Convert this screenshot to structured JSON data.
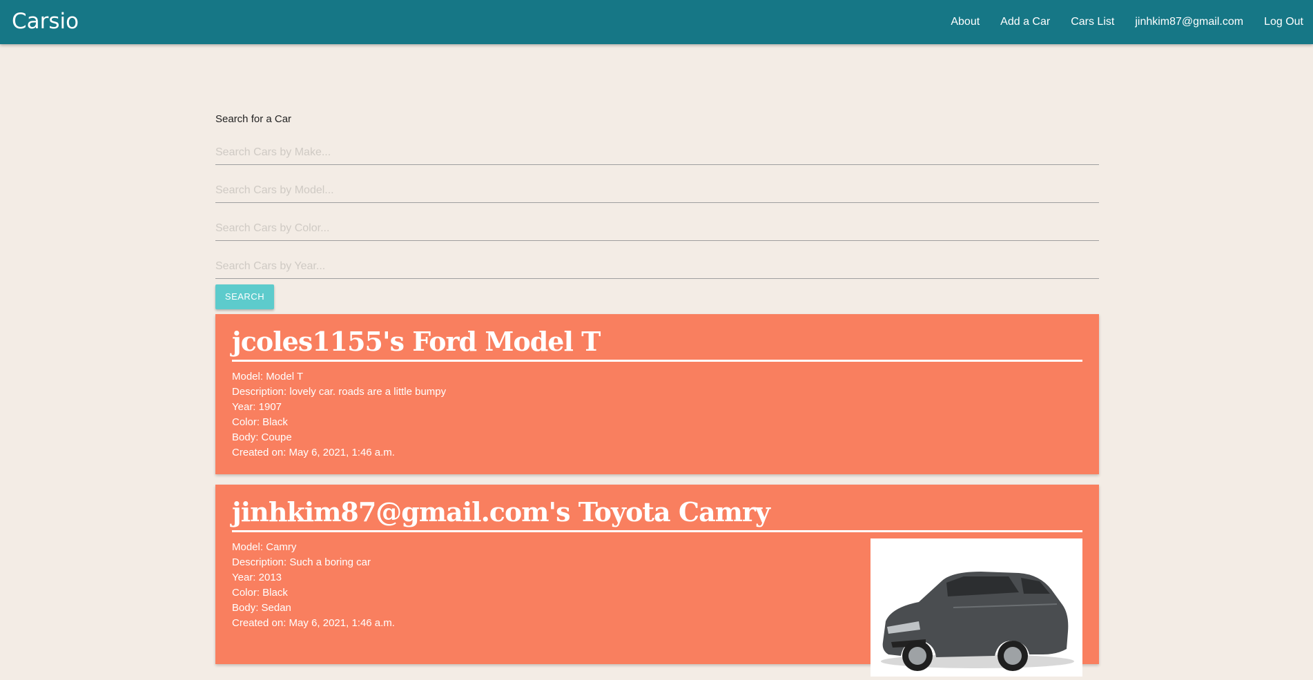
{
  "navbar": {
    "brand": "Carsio",
    "links": [
      "About",
      "Add a Car",
      "Cars List",
      "jinhkim87@gmail.com",
      "Log Out"
    ]
  },
  "search": {
    "label": "Search for a Car",
    "make_placeholder": "Search Cars by Make...",
    "model_placeholder": "Search Cars by Model...",
    "color_placeholder": "Search Cars by Color...",
    "year_placeholder": "Search Cars by Year...",
    "button_label": "SEARCH"
  },
  "cars": [
    {
      "title": "jcoles1155's Ford Model T",
      "model": "Model: Model T",
      "description": "Description: lovely car. roads are a little bumpy",
      "year": "Year: 1907",
      "color": "Color: Black",
      "body": "Body: Coupe",
      "created": "Created on: May 6, 2021, 1:46 a.m.",
      "has_image": false
    },
    {
      "title": "jinhkim87@gmail.com's Toyota Camry",
      "model": "Model: Camry",
      "description": "Description: Such a boring car",
      "year": "Year: 2013",
      "color": "Color: Black",
      "body": "Body: Sedan",
      "created": "Created on: May 6, 2021, 1:46 a.m.",
      "has_image": true,
      "image_icon": "gray-sedan-photo"
    }
  ],
  "colors": {
    "navbar": "#167786",
    "background": "#f3ece5",
    "card": "#f97f5f",
    "button": "#5dcbcc"
  }
}
